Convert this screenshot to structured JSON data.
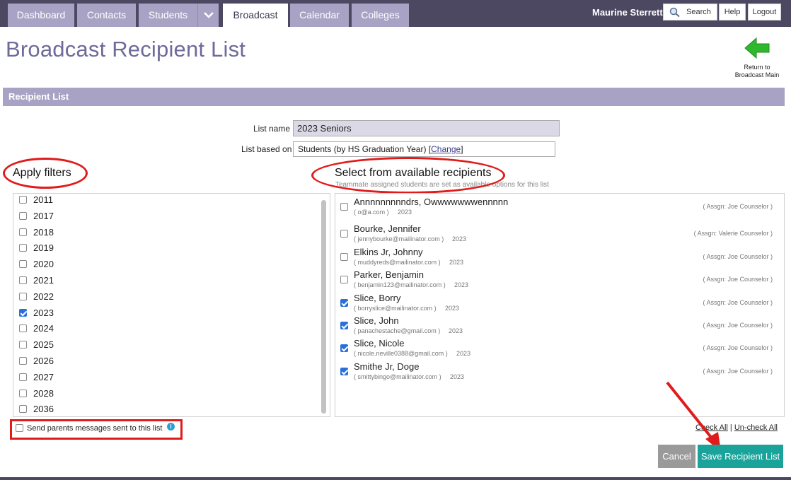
{
  "nav": {
    "tabs": [
      "Dashboard",
      "Contacts",
      "Students",
      "Broadcast",
      "Calendar",
      "Colleges"
    ],
    "active_tab": "Broadcast",
    "user_name": "Maurine Sterrett",
    "search_label": "Search",
    "help_label": "Help",
    "logout_label": "Logout"
  },
  "page": {
    "title": "Broadcast Recipient List",
    "return_label_line1": "Return to",
    "return_label_line2": "Broadcast Main"
  },
  "section": {
    "title": "Recipient List"
  },
  "form": {
    "list_name_label": "List name",
    "list_name_value": "2023 Seniors",
    "based_on_label": "List based on",
    "based_on_value": "Students (by HS Graduation Year)",
    "change_link": "Change"
  },
  "filters": {
    "heading": "Apply filters",
    "years": [
      {
        "label": "2011",
        "checked": false
      },
      {
        "label": "2017",
        "checked": false
      },
      {
        "label": "2018",
        "checked": false
      },
      {
        "label": "2019",
        "checked": false
      },
      {
        "label": "2020",
        "checked": false
      },
      {
        "label": "2021",
        "checked": false
      },
      {
        "label": "2022",
        "checked": false
      },
      {
        "label": "2023",
        "checked": true
      },
      {
        "label": "2024",
        "checked": false
      },
      {
        "label": "2025",
        "checked": false
      },
      {
        "label": "2026",
        "checked": false
      },
      {
        "label": "2027",
        "checked": false
      },
      {
        "label": "2028",
        "checked": false
      },
      {
        "label": "2036",
        "checked": false
      }
    ]
  },
  "recipients": {
    "heading": "Select from available recipients",
    "note": "Teammate assigned students are set as available options for this list",
    "items": [
      {
        "name": "Annnnnnnnndrs, Owwwwwwwennnnn",
        "email": "( o@a.com )",
        "year": "2023",
        "assign": "( Assgn: Joe Counselor )",
        "checked": false
      },
      {
        "name": "Bourke, Jennifer",
        "email": "( jennybourke@mailinator.com )",
        "year": "2023",
        "assign": "( Assgn: Valerie Counselor )",
        "checked": false
      },
      {
        "name": "Elkins Jr, Johnny",
        "email": "( muddyreds@mailinator.com )",
        "year": "2023",
        "assign": "( Assgn: Joe Counselor )",
        "checked": false
      },
      {
        "name": "Parker, Benjamin",
        "email": "( benjamin123@mailinator.com )",
        "year": "2023",
        "assign": "( Assgn: Joe Counselor )",
        "checked": false
      },
      {
        "name": "Slice, Borry",
        "email": "( borryslice@mailinator.com )",
        "year": "2023",
        "assign": "( Assgn: Joe Counselor )",
        "checked": true
      },
      {
        "name": "Slice, John",
        "email": "( panachestache@gmail.com )",
        "year": "2023",
        "assign": "( Assgn: Joe Counselor )",
        "checked": true
      },
      {
        "name": "Slice, Nicole",
        "email": "( nicole.neville0388@gmail.com )",
        "year": "2023",
        "assign": "( Assgn: Joe Counselor )",
        "checked": true
      },
      {
        "name": "Smithe Jr, Doge",
        "email": "( smittybingo@mailinator.com )",
        "year": "2023",
        "assign": "( Assgn: Joe Counselor )",
        "checked": true
      }
    ]
  },
  "options": {
    "send_parents_label": "Send parents messages sent to this list",
    "send_parents_checked": false,
    "check_all": "Check All",
    "uncheck_all": "Un-check All",
    "separator": "|"
  },
  "buttons": {
    "cancel": "Cancel",
    "save": "Save Recipient List"
  },
  "colors": {
    "accent": "#a8a3c4",
    "nav_bg": "#4c4861",
    "title": "#6e6a9a",
    "save_button": "#1aa39a",
    "cancel_button": "#9a9a9a",
    "annotation_red": "#e01b1b"
  }
}
